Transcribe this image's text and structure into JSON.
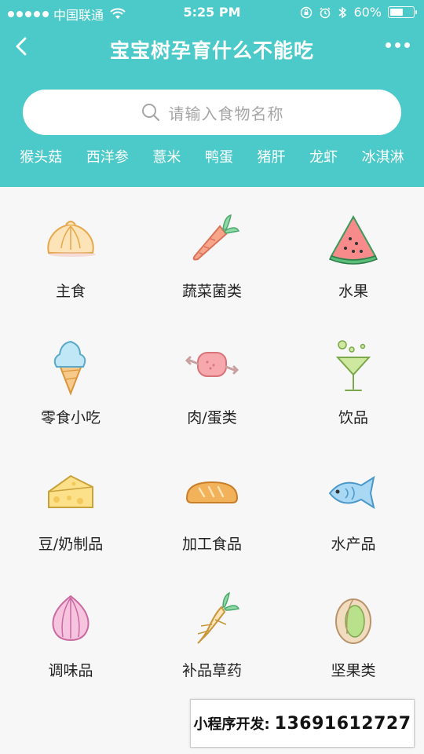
{
  "status_bar": {
    "carrier": "中国联通",
    "time": "5:25 PM",
    "battery": "60%",
    "battery_level": 0.6
  },
  "nav": {
    "title": "宝宝树孕育什么不能吃",
    "back_icon": "chevron-left-icon",
    "more_icon": "more-dots-icon"
  },
  "search": {
    "placeholder": "请输入食物名称",
    "icon": "search-icon"
  },
  "hot_tags": [
    "猴头菇",
    "西洋参",
    "薏米",
    "鸭蛋",
    "猪肝",
    "龙虾",
    "冰淇淋"
  ],
  "categories": [
    {
      "label": "主食",
      "icon": "steamed-bun-icon"
    },
    {
      "label": "蔬菜菌类",
      "icon": "carrot-icon"
    },
    {
      "label": "水果",
      "icon": "watermelon-icon"
    },
    {
      "label": "零食小吃",
      "icon": "ice-cream-icon"
    },
    {
      "label": "肉/蛋类",
      "icon": "meat-icon"
    },
    {
      "label": "饮品",
      "icon": "cocktail-icon"
    },
    {
      "label": "豆/奶制品",
      "icon": "cheese-icon"
    },
    {
      "label": "加工食品",
      "icon": "bread-icon"
    },
    {
      "label": "水产品",
      "icon": "fish-icon"
    },
    {
      "label": "调味品",
      "icon": "onion-icon"
    },
    {
      "label": "补品草药",
      "icon": "ginseng-icon"
    },
    {
      "label": "坚果类",
      "icon": "pistachio-icon"
    }
  ],
  "dev_banner": {
    "label": "小程序开发:",
    "phone": "13691612727"
  },
  "colors": {
    "header": "#4cc9c9",
    "background": "#f7f7f7"
  }
}
